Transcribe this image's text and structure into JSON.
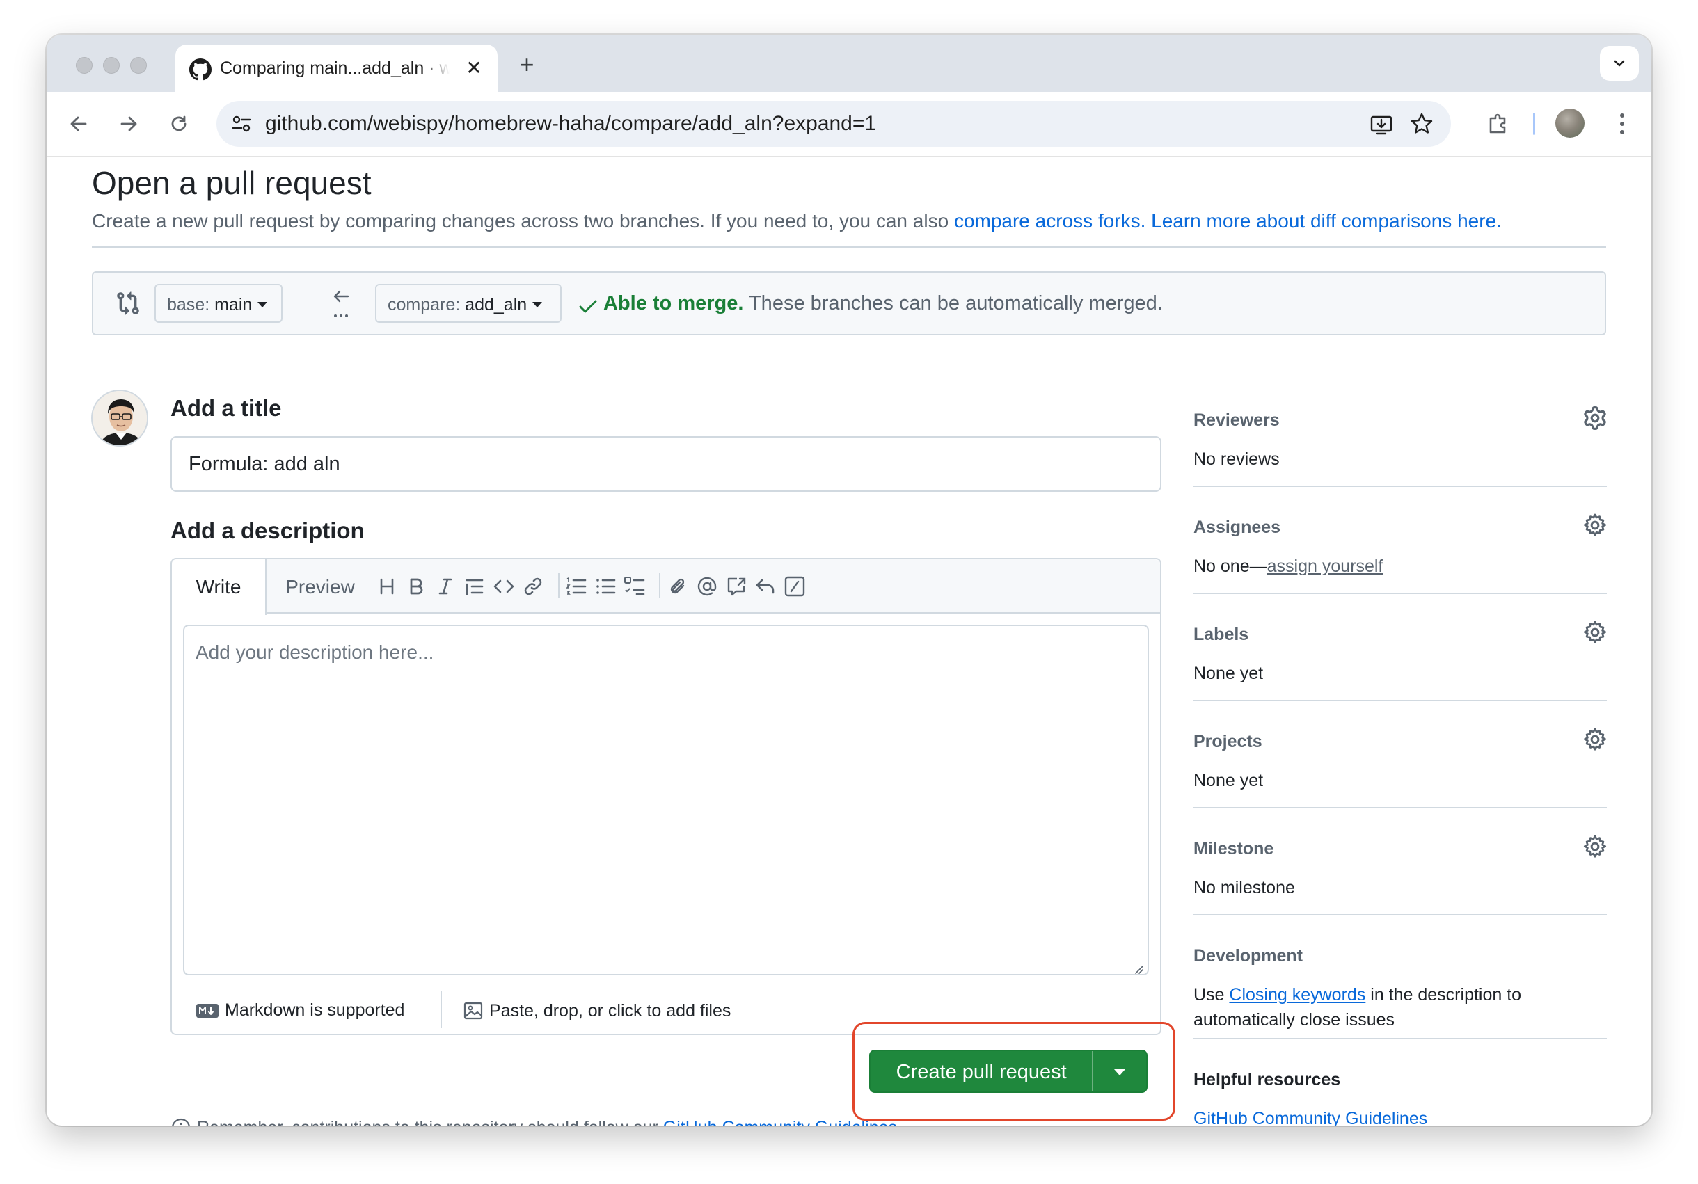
{
  "browser": {
    "tab_title": "Comparing main...add_aln · webispy/homebrew-haha",
    "url": "github.com/webispy/homebrew-haha/compare/add_aln?expand=1"
  },
  "page": {
    "title": "Open a pull request",
    "subtitle_text": "Create a new pull request by comparing changes across two branches. If you need to, you can also ",
    "subtitle_link1": "compare across forks.",
    "subtitle_link2": "Learn more about diff comparisons here."
  },
  "compare": {
    "base_prefix": "base: ",
    "base_branch": "main",
    "compare_prefix": "compare: ",
    "compare_branch": "add_aln",
    "merge_ok": "Able to merge.",
    "merge_text": " These branches can be automatically merged."
  },
  "form": {
    "title_label": "Add a title",
    "title_value": "Formula: add aln",
    "description_label": "Add a description",
    "tab_write": "Write",
    "tab_preview": "Preview",
    "description_placeholder": "Add your description here...",
    "markdown_hint": "Markdown is supported",
    "attach_hint": "Paste, drop, or click to add files",
    "create_button": "Create pull request",
    "note_text": "Remember, contributions to this repository should follow our ",
    "note_link": "GitHub Community Guidelines",
    "note_end": "."
  },
  "sidebar": {
    "reviewers": {
      "heading": "Reviewers",
      "value": "No reviews"
    },
    "assignees": {
      "heading": "Assignees",
      "value_prefix": "No one—",
      "value_link": "assign yourself"
    },
    "labels": {
      "heading": "Labels",
      "value": "None yet"
    },
    "projects": {
      "heading": "Projects",
      "value": "None yet"
    },
    "milestone": {
      "heading": "Milestone",
      "value": "No milestone"
    },
    "development": {
      "heading": "Development",
      "line1_prefix": "Use ",
      "line1_link": "Closing keywords",
      "line1_suffix": " in the description to",
      "line2": "automatically close issues"
    },
    "helpful": {
      "heading": "Helpful resources",
      "link": "GitHub Community Guidelines"
    }
  },
  "colors": {
    "link": "#0969da",
    "success": "#1a7f37",
    "primary_button": "#1f883d",
    "highlight": "#e2462b"
  }
}
